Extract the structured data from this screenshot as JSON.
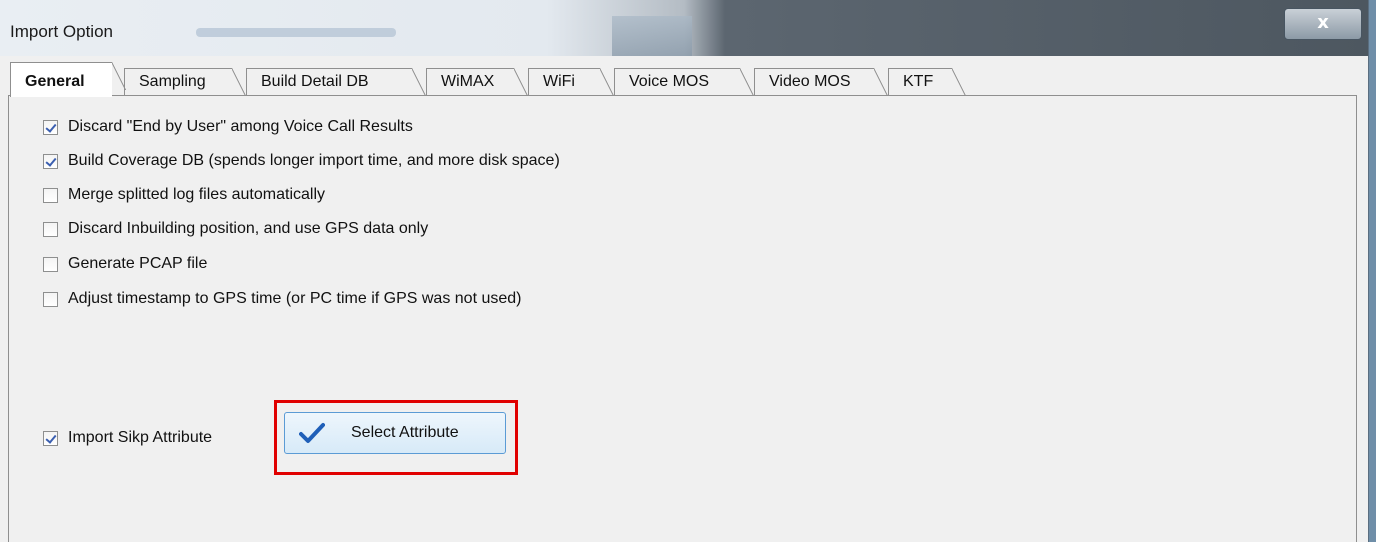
{
  "window": {
    "title": "Import Option",
    "close_label": "x"
  },
  "tabs": [
    {
      "label": "General",
      "active": true
    },
    {
      "label": "Sampling",
      "active": false
    },
    {
      "label": "Build Detail DB",
      "active": false
    },
    {
      "label": "WiMAX",
      "active": false
    },
    {
      "label": "WiFi",
      "active": false
    },
    {
      "label": "Voice MOS",
      "active": false
    },
    {
      "label": "Video MOS",
      "active": false
    },
    {
      "label": "KTF",
      "active": false
    }
  ],
  "options": [
    {
      "label": "Discard \"End by User\" among Voice Call Results",
      "checked": true
    },
    {
      "label": "Build Coverage DB (spends longer import time, and more disk space)",
      "checked": true
    },
    {
      "label": "Merge splitted log files automatically",
      "checked": false
    },
    {
      "label": "Discard Inbuilding position, and use GPS data only",
      "checked": false
    },
    {
      "label": "Generate PCAP file",
      "checked": false
    },
    {
      "label": "Adjust timestamp to GPS time (or PC time if GPS was not used)",
      "checked": false
    }
  ],
  "import_skip": {
    "label": "Import Sikp Attribute",
    "checked": true
  },
  "select_attribute": {
    "label": "Select Attribute",
    "icon": "checkmark-icon"
  },
  "colors": {
    "highlight": "#e00000",
    "check": "#3b5fb0",
    "button_border": "#5b9bd5"
  }
}
